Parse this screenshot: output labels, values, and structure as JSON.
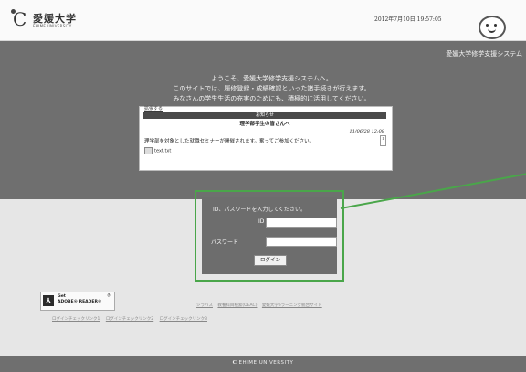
{
  "header": {
    "logo_mark": "C",
    "logo_jp": "愛媛大学",
    "logo_en": "EHIME UNIVERSITY",
    "datetime": "2012年7月10日 19:57:05",
    "mascot_icon": "mascot-icon"
  },
  "top": {
    "system_name": "愛媛大学修学支援システム",
    "welcome": [
      "ようこそ、愛媛大学修学支援システムへ。",
      "このサイトでは、履修登録・成績確認といった諸手続きが行えます。",
      "みなさんの学生生活の充実のためにも、積極的に活用してください。"
    ],
    "notice": {
      "link": "拡張する",
      "heading": "お知らせ",
      "title": "理学部学生の皆さんへ",
      "date": "11/06/28 12:08",
      "body": "理学部を対象とした就職セミナーが開催されます。奮ってご参加ください。",
      "file": "text.txt"
    }
  },
  "login": {
    "title": "ID、パスワードを入力してください。",
    "id_label": "ID",
    "pw_label": "パスワード",
    "button": "ログイン"
  },
  "links": {
    "adobe_line1": "Get",
    "adobe_line2": "ADOBE® READER®",
    "row1": [
      "シラバス",
      "教養科目検索(OEAC)",
      "愛媛大学eラーニング統合サイト"
    ],
    "row2": [
      "ログインチェックリンク1",
      "ログインチェックリンク2",
      "ログインチェックリンク3"
    ]
  },
  "footer": {
    "text": "EHIME UNIVERSITY"
  },
  "colors": {
    "panel": "#6f6f6f",
    "highlight": "#4aa64a",
    "background": "#e6e6e6"
  }
}
